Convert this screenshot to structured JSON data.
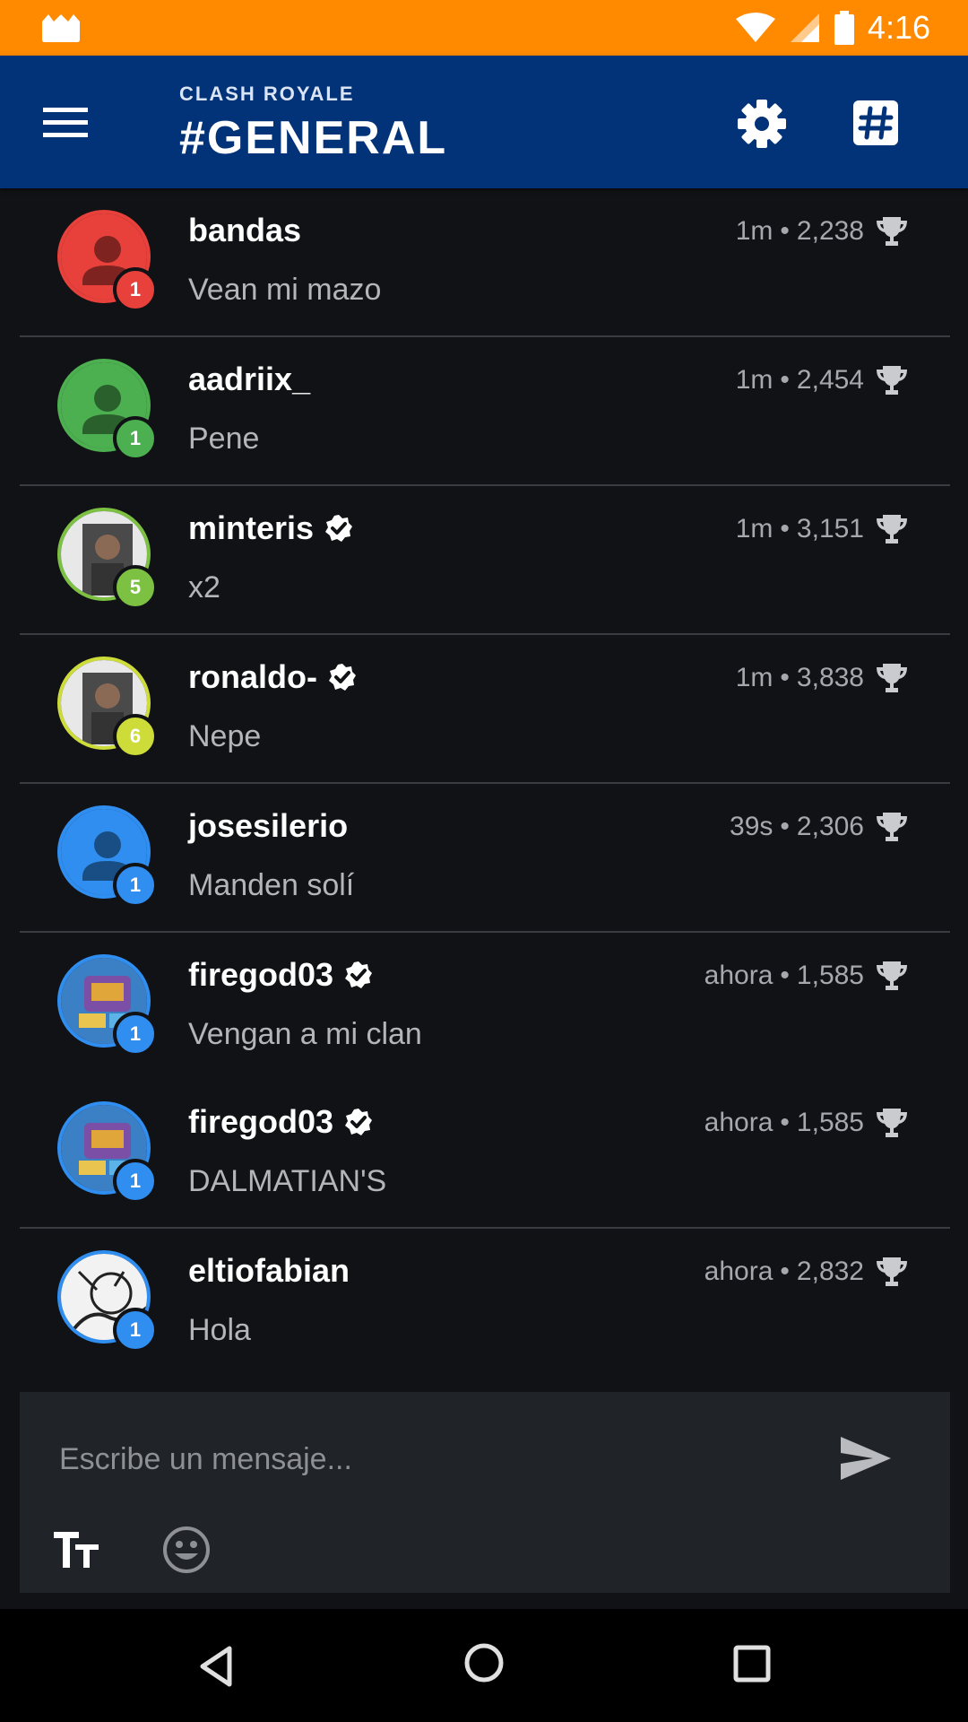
{
  "status_bar": {
    "time": "4:16"
  },
  "header": {
    "subtitle": "CLASH ROYALE",
    "title": "#GENERAL"
  },
  "messages": [
    {
      "user": "bandas",
      "verified": false,
      "time": "1m",
      "trophies": "2,238",
      "text": "Vean mi mazo",
      "level": "1",
      "avatar_color": "#e8413b",
      "avatar_type": "default"
    },
    {
      "user": "aadriix_",
      "verified": false,
      "time": "1m",
      "trophies": "2,454",
      "text": "Pene",
      "level": "1",
      "avatar_color": "#4caf50",
      "avatar_type": "default"
    },
    {
      "user": "minteris",
      "verified": true,
      "time": "1m",
      "trophies": "3,151",
      "text": "x2",
      "level": "5",
      "avatar_color": "#7cc142",
      "avatar_type": "photo"
    },
    {
      "user": "ronaldo-",
      "verified": true,
      "time": "1m",
      "trophies": "3,838",
      "text": "Nepe",
      "level": "6",
      "avatar_color": "#cddc39",
      "avatar_type": "photo"
    },
    {
      "user": "josesilerio",
      "verified": false,
      "time": "39s",
      "trophies": "2,306",
      "text": "Manden solí",
      "level": "1",
      "avatar_color": "#2f8ef0",
      "avatar_type": "default"
    },
    {
      "user": "firegod03",
      "verified": true,
      "time": "ahora",
      "trophies": "1,585",
      "text": "Vengan a mi clan",
      "level": "1",
      "avatar_color": "#2f8ef0",
      "avatar_type": "game"
    },
    {
      "user": "firegod03",
      "verified": true,
      "time": "ahora",
      "trophies": "1,585",
      "text": "DALMATIAN'S",
      "level": "1",
      "avatar_color": "#2f8ef0",
      "avatar_type": "game"
    },
    {
      "user": "eltiofabian",
      "verified": false,
      "time": "ahora",
      "trophies": "2,832",
      "text": "Hola",
      "level": "1",
      "avatar_color": "#2f8ef0",
      "avatar_type": "drawing"
    }
  ],
  "composer": {
    "placeholder": "Escribe un mensaje..."
  },
  "icons": {
    "menu": "hamburger-icon",
    "settings": "gear-icon",
    "hashtag": "hashtag-icon",
    "trophy": "trophy-icon",
    "verified": "verified-badge-icon",
    "send": "send-icon",
    "text_format": "text-format-icon",
    "emoji": "emoji-icon",
    "nav_back": "back-triangle-icon",
    "nav_home": "home-circle-icon",
    "nav_recent": "recent-square-icon"
  },
  "colors": {
    "status_bar": "#ff8a00",
    "app_bar": "#023278",
    "background": "#111215",
    "composer": "#202327",
    "level_badge": "#2f8ef0"
  }
}
